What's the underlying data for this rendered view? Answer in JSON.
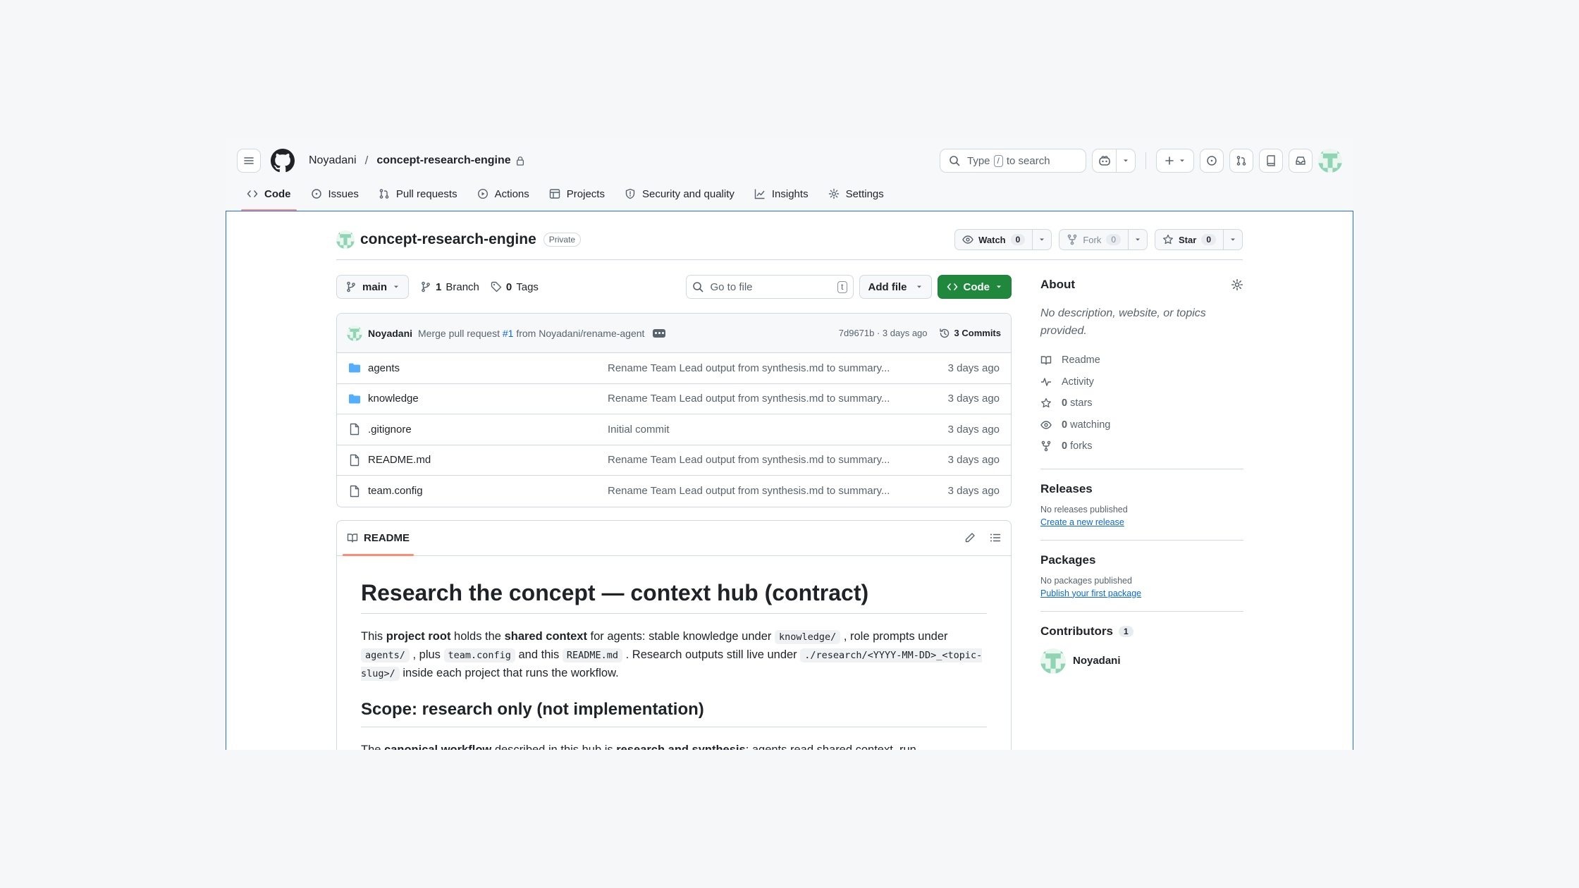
{
  "header": {
    "owner": "Noyadani",
    "separator": "/",
    "repo": "concept-research-engine",
    "search_prefix": "Type",
    "search_key": "/",
    "search_suffix": "to search"
  },
  "nav": [
    {
      "label": "Code",
      "icon": "code-icon",
      "active": true
    },
    {
      "label": "Issues",
      "icon": "issue-icon"
    },
    {
      "label": "Pull requests",
      "icon": "pull-request-icon"
    },
    {
      "label": "Actions",
      "icon": "play-icon"
    },
    {
      "label": "Projects",
      "icon": "table-icon"
    },
    {
      "label": "Security and quality",
      "icon": "shield-icon"
    },
    {
      "label": "Insights",
      "icon": "graph-icon"
    },
    {
      "label": "Settings",
      "icon": "gear-icon"
    }
  ],
  "repo_head": {
    "title": "concept-research-engine",
    "visibility": "Private",
    "watch_label": "Watch",
    "watch_count": "0",
    "fork_label": "Fork",
    "fork_count": "0",
    "star_label": "Star",
    "star_count": "0"
  },
  "toolbar": {
    "branch": "main",
    "branches_count": "1",
    "branches_label": "Branch",
    "tags_count": "0",
    "tags_label": "Tags",
    "goto_placeholder": "Go to file",
    "goto_key": "t",
    "add_file": "Add file",
    "code": "Code"
  },
  "commit": {
    "author": "Noyadani",
    "msg_prefix": "Merge pull request",
    "pr": "#1",
    "msg_suffix": "from Noyadani/rename-agent",
    "sha_time": "7d9671b · 3 days ago",
    "commits": "3 Commits"
  },
  "files": [
    {
      "type": "folder",
      "name": "agents",
      "message": "Rename Team Lead output from synthesis.md to summary...",
      "date": "3 days ago"
    },
    {
      "type": "folder",
      "name": "knowledge",
      "message": "Rename Team Lead output from synthesis.md to summary...",
      "date": "3 days ago"
    },
    {
      "type": "file",
      "name": ".gitignore",
      "message": "Initial commit",
      "date": "3 days ago"
    },
    {
      "type": "file",
      "name": "README.md",
      "message": "Rename Team Lead output from synthesis.md to summary...",
      "date": "3 days ago"
    },
    {
      "type": "file",
      "name": "team.config",
      "message": "Rename Team Lead output from synthesis.md to summary...",
      "date": "3 days ago"
    }
  ],
  "readme": {
    "tab": "README",
    "h1": "Research the concept — context hub (contract)",
    "p1": {
      "t1": "This ",
      "b1": "project root",
      "t2": " holds the ",
      "b2": "shared context",
      "t3": " for agents: stable knowledge under ",
      "c1": "knowledge/",
      "t4": " , role prompts under ",
      "c2": "agents/",
      "t5": " , plus ",
      "c3": "team.config",
      "t6": " and this ",
      "c4": "README.md",
      "t7": " . Research outputs still live under ",
      "c5": "./research/<YYYY-MM-DD>_<topic-slug>/",
      "t8": " inside each project that runs the workflow."
    },
    "h2": "Scope: research only (not implementation)",
    "p2": {
      "t1": "The ",
      "b1": "canonical workflow",
      "t2": " described in this hub is ",
      "b2": "research and synthesis",
      "t3": ": agents read shared context, run"
    }
  },
  "sidebar": {
    "about_title": "About",
    "about_desc": "No description, website, or topics provided.",
    "items": [
      {
        "icon": "book-icon",
        "label": "Readme"
      },
      {
        "icon": "pulse-icon",
        "label": "Activity"
      },
      {
        "icon": "star-icon",
        "count": "0",
        "label": "stars"
      },
      {
        "icon": "eye-icon",
        "count": "0",
        "label": "watching"
      },
      {
        "icon": "fork-icon",
        "count": "0",
        "label": "forks"
      }
    ],
    "releases_title": "Releases",
    "releases_none": "No releases published",
    "releases_link": "Create a new release",
    "packages_title": "Packages",
    "packages_none": "No packages published",
    "packages_link": "Publish your first package",
    "contributors_title": "Contributors",
    "contributors_count": "1",
    "contributor_name": "Noyadani"
  },
  "colors": {
    "accent_green": "#1f883d",
    "link_blue": "#0969da",
    "tab_underline": "#fd8c73",
    "folder_blue": "#54aeff",
    "page_border": "#1f6feb"
  }
}
